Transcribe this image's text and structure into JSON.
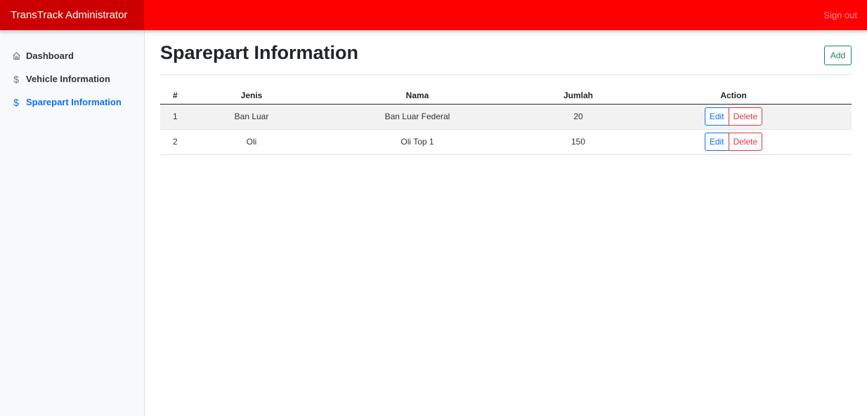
{
  "app": {
    "brand": "TransTrack Administrator",
    "sign_out": "Sign out",
    "accent_color": "#ff0000"
  },
  "sidebar": {
    "items": [
      {
        "label": "Dashboard",
        "icon": "home-icon",
        "active": false
      },
      {
        "label": "Vehicle Information",
        "icon": "dollar-icon",
        "active": false
      },
      {
        "label": "Sparepart Information",
        "icon": "dollar-icon",
        "active": true
      }
    ]
  },
  "main": {
    "title": "Sparepart Information",
    "add_label": "Add",
    "table": {
      "headers": [
        "#",
        "Jenis",
        "Nama",
        "Jumlah",
        "Action"
      ],
      "rows": [
        {
          "no": "1",
          "jenis": "Ban Luar",
          "nama": "Ban Luar Federal",
          "jumlah": "20"
        },
        {
          "no": "2",
          "jenis": "Oli",
          "nama": "Oli Top 1",
          "jumlah": "150"
        }
      ],
      "edit_label": "Edit",
      "delete_label": "Delete"
    }
  }
}
